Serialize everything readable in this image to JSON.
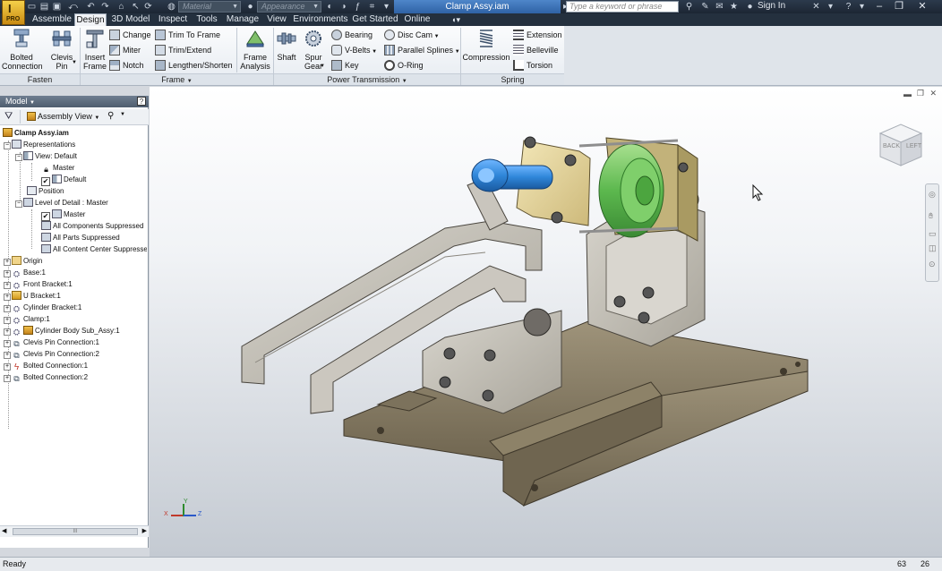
{
  "app": {
    "logo_letter": "I",
    "logo_edition": "PRO"
  },
  "qat": {
    "material_placeholder": "Material",
    "appearance_placeholder": "Appearance"
  },
  "document": {
    "title": "Clamp Assy.iam"
  },
  "search": {
    "placeholder": "Type a keyword or phrase"
  },
  "account": {
    "signin": "Sign In"
  },
  "tabs": [
    {
      "label": "Assemble"
    },
    {
      "label": "Design",
      "active": true
    },
    {
      "label": "3D Model"
    },
    {
      "label": "Inspect"
    },
    {
      "label": "Tools"
    },
    {
      "label": "Manage"
    },
    {
      "label": "View"
    },
    {
      "label": "Environments"
    },
    {
      "label": "Get Started"
    },
    {
      "label": "Online"
    }
  ],
  "ribbon": {
    "fasten": {
      "title": "Fasten",
      "bolted_connection": {
        "l1": "Bolted",
        "l2": "Connection"
      },
      "clevis_pin": {
        "l1": "Clevis",
        "l2": "Pin"
      }
    },
    "frame": {
      "title": "Frame",
      "insert_frame": {
        "l1": "Insert",
        "l2": "Frame"
      },
      "change": "Change",
      "miter": "Miter",
      "notch": "Notch",
      "trim_to_frame": "Trim To Frame",
      "trim_extend": "Trim/Extend",
      "lengthen_shorten": "Lengthen/Shorten",
      "frame_analysis": {
        "l1": "Frame",
        "l2": "Analysis"
      }
    },
    "power_transmission": {
      "title": "Power Transmission",
      "shaft": "Shaft",
      "spur_gear": {
        "l1": "Spur",
        "l2": "Gear"
      },
      "bearing": "Bearing",
      "v_belts": "V-Belts",
      "key": "Key",
      "disc_cam": "Disc Cam",
      "parallel_splines": "Parallel Splines",
      "o_ring": "O-Ring"
    },
    "spring": {
      "title": "Spring",
      "compression": "Compression",
      "extension": "Extension",
      "belleville": "Belleville",
      "torsion": "Torsion"
    }
  },
  "browser": {
    "header": "Model",
    "view_selector": "Assembly View",
    "help": "?",
    "tree": [
      {
        "label": "Clamp Assy.iam",
        "bold": true
      },
      {
        "label": "Representations"
      },
      {
        "label": "View: Default"
      },
      {
        "label": "Master"
      },
      {
        "label": "Default"
      },
      {
        "label": "Position"
      },
      {
        "label": "Level of Detail : Master"
      },
      {
        "label": "Master"
      },
      {
        "label": "All Components Suppressed"
      },
      {
        "label": "All Parts Suppressed"
      },
      {
        "label": "All Content Center Suppressed"
      },
      {
        "label": "Origin"
      },
      {
        "label": "Base:1"
      },
      {
        "label": "Front Bracket:1"
      },
      {
        "label": "U Bracket:1"
      },
      {
        "label": "Cylinder Bracket:1"
      },
      {
        "label": "Clamp:1"
      },
      {
        "label": "Cylinder Body Sub_Assy:1"
      },
      {
        "label": "Clevis Pin Connection:1"
      },
      {
        "label": "Clevis Pin Connection:2"
      },
      {
        "label": "Bolted Connection:1"
      },
      {
        "label": "Bolted Connection:2"
      }
    ],
    "hscroll_grip": "III"
  },
  "viewcube": {
    "face_left": "BACK",
    "face_right": "LEFT"
  },
  "triad": {
    "x": "X",
    "y": "Y",
    "z": "Z"
  },
  "status": {
    "text": "Ready",
    "count_a": "63",
    "count_b": "26"
  },
  "colors": {
    "titlebar": "#1c2633",
    "doc_title": "#3a74bb",
    "viewport_top": "#ffffff",
    "viewport_bottom": "#c4cad2",
    "base_plate": "#857a62",
    "bracket": "#c5c1b8",
    "cylinder_block": "#e9d9a0",
    "cylinder_body": "#6cc35e",
    "clevis": "#2f86d9"
  }
}
